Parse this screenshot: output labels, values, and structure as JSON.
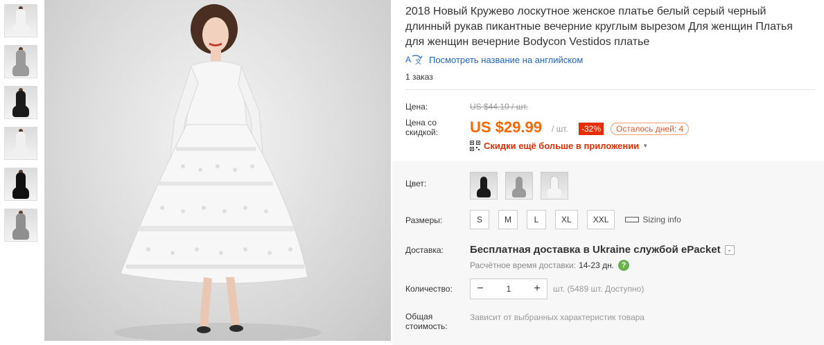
{
  "thumbnails": [
    {
      "icon": "dress-photo-icon",
      "dress_color": "#f2f2f2"
    },
    {
      "icon": "dress-photo-icon",
      "dress_color": "#9a9a9a"
    },
    {
      "icon": "dress-photo-icon",
      "dress_color": "#1a1a1a"
    },
    {
      "icon": "dress-photo-icon",
      "dress_color": "#f0f0f0"
    },
    {
      "icon": "dress-photo-icon",
      "dress_color": "#111111"
    },
    {
      "icon": "dress-photo-icon",
      "dress_color": "#8f8f8f"
    }
  ],
  "product": {
    "title": "2018 Новый Кружево лоскутное женское платье белый серый черный длинный рукав пикантные вечерние круглым вырезом Для женщин Платья для женщин вечерние Bodycon Vestidos платье",
    "translate_link": "Посмотреть название на английском",
    "orders": "1 заказ"
  },
  "pricing": {
    "price_label": "Цена:",
    "old_price": "US $44.10 / шт.",
    "discount_label": "Цена со скидкой:",
    "price": "US $29.99",
    "per_unit": "/ шт.",
    "discount_badge": "-32%",
    "days_left": "Осталось дней: 4",
    "app_promo": "Скидки ещё больше в приложении"
  },
  "options": {
    "color_label": "Цвет:",
    "colors": [
      {
        "name": "black",
        "hex": "#1a1a1a"
      },
      {
        "name": "gray",
        "hex": "#9a9a9a"
      },
      {
        "name": "white",
        "hex": "#f5f5f5"
      }
    ],
    "size_label": "Размеры:",
    "sizes": [
      "S",
      "M",
      "L",
      "XL",
      "XXL"
    ],
    "sizing_info": "Sizing info"
  },
  "shipping": {
    "label": "Доставка:",
    "method": "Бесплатная доставка в Ukraine службой ePacket",
    "eta_label": "Расчётное время доставки:",
    "eta_value": "14-23 дн.",
    "help_icon": "?"
  },
  "quantity": {
    "label": "Количество:",
    "minus": "−",
    "value": "1",
    "plus": "+",
    "available": "шт. (5489 шт. Доступно)"
  },
  "total": {
    "label": "Общая стоимость:",
    "value": "Зависит от выбранных характеристик товара"
  },
  "colors": {
    "accent_price": "#ff6600",
    "discount_red": "#e62e04",
    "link_blue": "#1f63c6",
    "help_green": "#6ab04c"
  }
}
